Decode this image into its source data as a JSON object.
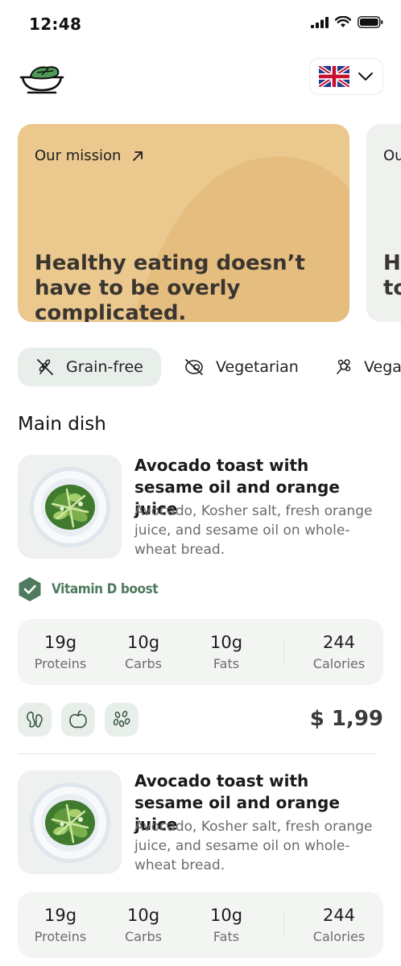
{
  "status_bar": {
    "time": "12:48"
  },
  "header": {
    "language": "English (UK)"
  },
  "mission_card": {
    "label": "Our mission",
    "text": "Healthy eating doesn’t have to be overly complicated.",
    "bg_color": "#ebc88e"
  },
  "second_card": {
    "label": "Ou",
    "text": "H\nto"
  },
  "filters": [
    {
      "label": "Grain-free",
      "icon": "grain-free-icon",
      "active": true
    },
    {
      "label": "Vegetarian",
      "icon": "vegetarian-icon",
      "active": false
    },
    {
      "label": "Vegan",
      "icon": "vegan-icon",
      "active": false
    }
  ],
  "section": {
    "title": "Main dish"
  },
  "dishes": [
    {
      "name": "Avocado toast with sesame oil and orange juice",
      "description": "Avocado, Kosher salt, fresh orange juice, and sesame oil on whole-wheat bread.",
      "badge": "Vitamin D boost",
      "nutrition": [
        {
          "value": "19g",
          "label": "Proteins"
        },
        {
          "value": "10g",
          "label": "Carbs"
        },
        {
          "value": "10g",
          "label": "Fats"
        },
        {
          "value": "244",
          "label": "Calories"
        }
      ],
      "tags": [
        "beans-icon",
        "apple-icon",
        "seeds-icon"
      ],
      "price": "$ 1,99"
    },
    {
      "name": "Avocado toast with sesame oil and orange juice",
      "description": "Avocado, Kosher salt, fresh orange juice, and sesame oil on whole-wheat bread.",
      "nutrition": [
        {
          "value": "19g",
          "label": "Proteins"
        },
        {
          "value": "10g",
          "label": "Carbs"
        },
        {
          "value": "10g",
          "label": "Fats"
        },
        {
          "value": "244",
          "label": "Calories"
        }
      ]
    }
  ],
  "colors": {
    "accent_green": "#4f7a5e",
    "chip_bg": "#e8efea",
    "card_bg": "#f3f5f3",
    "mission_bg": "#ebc88e"
  }
}
